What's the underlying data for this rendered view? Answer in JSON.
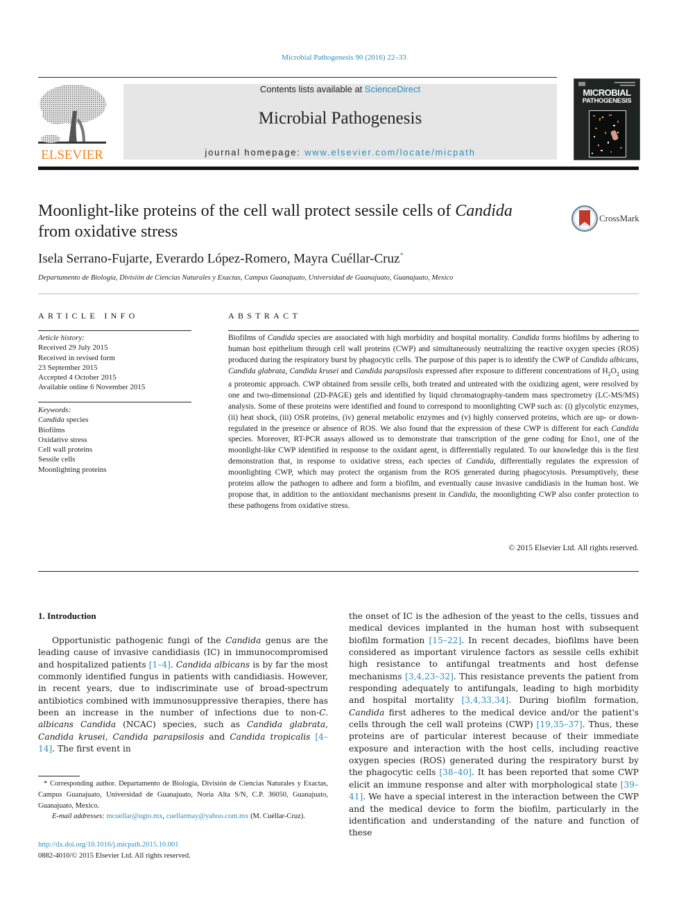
{
  "header": {
    "citation": "Microbial Pathogenesis 90 (2016) 22–33",
    "contents_prefix": "Contents lists available at ",
    "contents_link": "ScienceDirect",
    "journal_name": "Microbial Pathogenesis",
    "homepage_prefix": "journal homepage: ",
    "homepage_link": "www.elsevier.com/locate/micpath",
    "publisher_logo": "ELSEVIER",
    "cover_title_line1": "MICROBIAL",
    "cover_title_line2": "PATHOGENESIS",
    "cover_icon": "journal-cover-image"
  },
  "article": {
    "title_part1": "Moonlight-like proteins of the cell wall protect sessile cells of ",
    "title_italic": "Candida",
    "title_part2": "from oxidative stress",
    "crossmark_label": "CrossMark",
    "authors": "Isela Serrano-Fujarte, Everardo López-Romero, Mayra Cuéllar-Cruz",
    "corresponding_marker": "*",
    "affiliation": "Departamento de Biología, División de Ciencias Naturales y Exactas, Campus Guanajuato, Universidad de Guanajuato, Guanajuato, Mexico"
  },
  "article_info": {
    "heading": "ARTICLE INFO",
    "history_label": "Article history:",
    "history": [
      "Received 29 July 2015",
      "Received in revised form",
      "23 September 2015",
      "Accepted 4 October 2015",
      "Available online 6 November 2015"
    ],
    "keywords_label": "Keywords:",
    "keyword_first_italic": "Candida",
    "keyword_first_rest": " species",
    "keywords": [
      "Biofilms",
      "Oxidative stress",
      "Cell wall proteins",
      "Sessile cells",
      "Moonlighting proteins"
    ]
  },
  "abstract": {
    "heading": "ABSTRACT",
    "s1": "Biofilms of ",
    "s2": "Candida",
    "s3": " species are associated with high morbidity and hospital mortality. ",
    "s4": "Candida",
    "s5": " forms biofilms by adhering to human host epithelium through cell wall proteins (CWP) and simultaneously neutralizing the reactive oxygen species (ROS) produced during the respiratory burst by phagocytic cells. The purpose of this paper is to identify the CWP of ",
    "s6": "Candida albicans",
    "s7": ", ",
    "s8": "Candida glabrata",
    "s9": ", ",
    "s10": "Candida krusei",
    "s11": " and ",
    "s12": "Candida parapsilosis",
    "s13": " expressed after exposure to different concentrations of H",
    "s14": "2",
    "s15": "O",
    "s16": "2",
    "s17": " using a proteomic approach. CWP obtained from sessile cells, both treated and untreated with the oxidizing agent, were resolved by one and two-dimensional (2D-PAGE) gels and identified by liquid chromatography-tandem mass spectrometry (LC-MS/MS) analysis. Some of these proteins were identified and found to correspond to moonlighting CWP such as: (i) glycolytic enzymes, (ii) heat shock, (iii) OSR proteins, (iv) general metabolic enzymes and (v) highly conserved proteins, which are up- or down-regulated in the presence or absence of ROS. We also found that the expression of these CWP is different for each ",
    "s18": "Candida",
    "s19": " species. Moreover, RT-PCR assays allowed us to demonstrate that transcription of the gene coding for Eno1, one of the moonlight-like CWP identified in response to the oxidant agent, is differentially regulated. To our knowledge this is the first demonstration that, in response to oxidative stress, each species of ",
    "s20": "Candida",
    "s21": ", differentially regulates the expression of moonlighting CWP, which may protect the organism from the ROS generated during phagocytosis. Presumptively, these proteins allow the pathogen to adhere and form a biofilm, and eventually cause invasive candidiasis in the human host. We propose that, in addition to the antioxidant mechanisms present in ",
    "s22": "Candida",
    "s23": ", the moonlighting CWP also confer protection to these pathogens from oxidative stress.",
    "copyright": "© 2015 Elsevier Ltd. All rights reserved."
  },
  "introduction": {
    "heading": "1.  Introduction",
    "left": {
      "t1": "Opportunistic pathogenic fungi of the ",
      "t2": "Candida",
      "t3": " genus are the leading cause of invasive candidiasis (IC) in immunocompromised and hospitalized patients ",
      "r1": "[1–4]",
      "t4": ". ",
      "t5": "Candida albicans",
      "t6": " is by far the most commonly identified fungus in patients with candidiasis. However, in recent years, due to indiscriminate use of broad-spectrum antibiotics combined with immunosuppressive therapies, there has been an increase in the number of infections due to non-",
      "t7": "C. albicans Candida",
      "t8": " (NCAC) species, such as ",
      "t9": "Candida glabrata",
      "t10": ", ",
      "t11": "Candida krusei",
      "t12": ", ",
      "t13": "Candida parapsilosis",
      "t14": " and ",
      "t15": "Candida tropicalis",
      "t16": " ",
      "r2": "[4–14]",
      "t17": ". The first event in"
    },
    "right": {
      "t1": "the onset of IC is the adhesion of the yeast to the cells, tissues and medical devices implanted in the human host with subsequent biofilm formation ",
      "r1": "[15–22]",
      "t2": ". In recent decades, biofilms have been considered as important virulence factors as sessile cells exhibit high resistance to antifungal treatments and host defense mechanisms ",
      "r2": "[3,4,23–32]",
      "t3": ". This resistance prevents the patient from responding adequately to antifungals, leading to high morbidity and hospital mortality ",
      "r3": "[3,4,33,34]",
      "t4": ". During biofilm formation, ",
      "t5": "Candida",
      "t6": " first adheres to the medical device and/or the patient's cells through the cell wall proteins (CWP) ",
      "r4": "[19,35–37]",
      "t7": ". Thus, these proteins are of particular interest because of their immediate exposure and interaction with the host cells, including reactive oxygen species (ROS) generated during the respiratory burst by the phagocytic cells ",
      "r5": "[38–40]",
      "t8": ". It has been reported that some CWP elicit an immune response and alter with morphological state ",
      "r6": "[39–41]",
      "t9": ". We have a special interest in the interaction between the CWP and the medical device to form the biofilm, particularly in the identification and understanding of the nature and function of these"
    }
  },
  "footnote": {
    "text": "* Corresponding author. Departamento de Biología, División de Ciencias Naturales y Exactas, Campus Guanajuato, Universidad de Guanajuato, Noria Alta S/N, C.P. 36050, Guanajuato, Guanajuato, Mexico.",
    "email_label": "E-mail addresses:",
    "email1": "mcuellar@ugto.mx",
    "sep": ", ",
    "email2": "cuellarmay@yahoo.com.mx",
    "email_suffix": " (M. Cuéllar-Cruz)."
  },
  "doi": {
    "link": "http://dx.doi.org/10.1016/j.micpath.2015.10.001",
    "issn": "0882-4010/© 2015 Elsevier Ltd. All rights reserved."
  },
  "colors": {
    "link": "#2a8cbc",
    "elsevier_orange": "#f0861c",
    "masthead_gray": "#e6e6e6"
  }
}
